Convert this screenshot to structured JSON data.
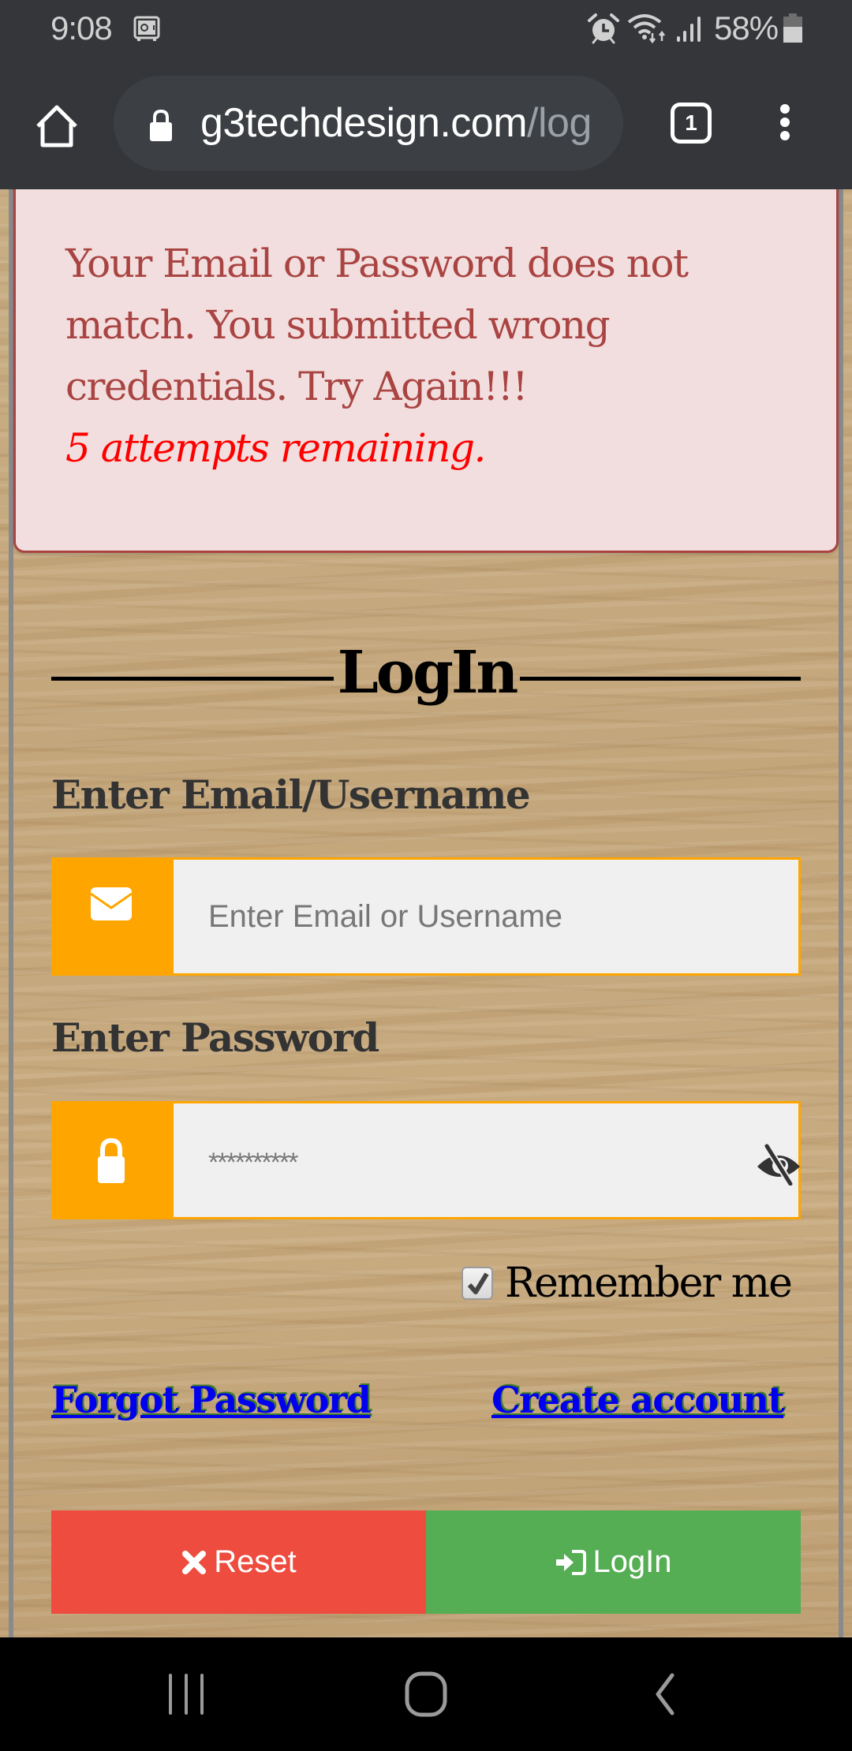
{
  "status_bar": {
    "time": "9:08",
    "battery_percent": "58%",
    "icons": [
      "safe-icon",
      "alarm-icon",
      "wifi-icon",
      "signal-icon",
      "battery-icon"
    ]
  },
  "browser": {
    "url_host": "g3techdesign.com",
    "url_path": "/log",
    "tab_count": "1",
    "icons": [
      "home-icon",
      "lock-icon",
      "tab-switcher-icon",
      "more-vert-icon"
    ]
  },
  "alert": {
    "message": "Your Email or Password does not match. You submitted wrong credentials. Try Again!!!",
    "attempts": "5 attempts remaining.",
    "colors": {
      "background": "#f2dede",
      "text": "#a94442",
      "attempts": "#ff0000"
    }
  },
  "form": {
    "heading": "LogIn",
    "email_label": "Enter Email/Username",
    "email_placeholder": "Enter Email or Username",
    "email_value": "",
    "password_label": "Enter Password",
    "password_value": "**********",
    "remember_label": "Remember me",
    "remember_checked": true,
    "forgot_link": "Forgot Password",
    "create_link": "Create account",
    "reset_button": "Reset",
    "login_button": "LogIn",
    "colors": {
      "addon": "#ffa500",
      "reset": "#ed4c3e",
      "login": "#55ae53",
      "link": "#0000ee"
    }
  },
  "navbar": {
    "icons": [
      "recent-apps-icon",
      "home-icon",
      "back-icon"
    ]
  }
}
